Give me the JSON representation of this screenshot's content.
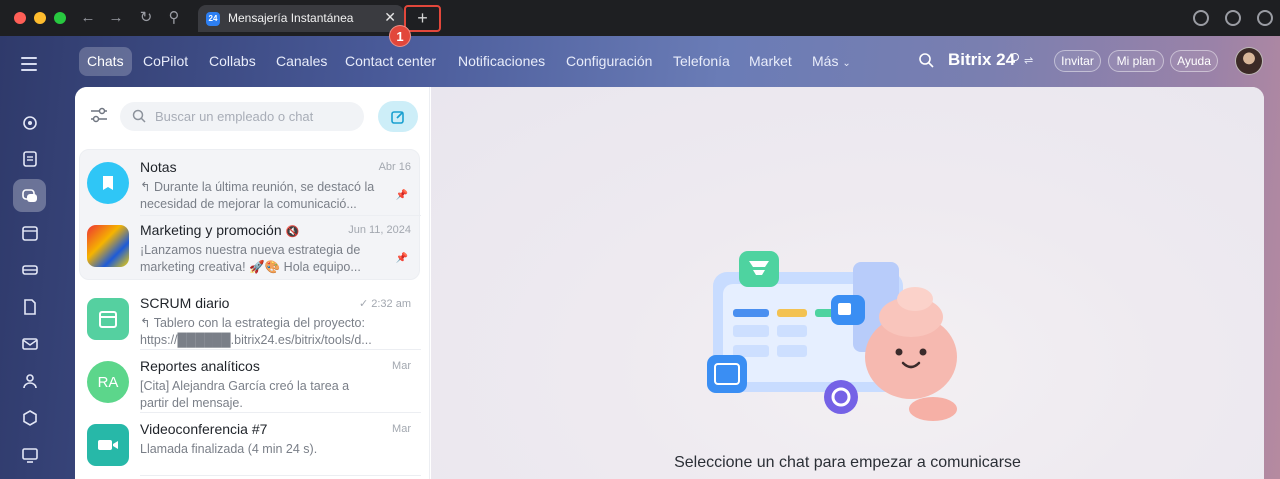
{
  "browser": {
    "tab_title": "Mensajería Instantánea",
    "tab_favicon": "24",
    "new_tab_symbol": "+",
    "step_marker": "1"
  },
  "menu": {
    "items": [
      {
        "label": "Chats",
        "active": true
      },
      {
        "label": "CoPilot"
      },
      {
        "label": "Collabs"
      },
      {
        "label": "Canales"
      },
      {
        "label": "Contact center"
      },
      {
        "label": "Notificaciones"
      },
      {
        "label": "Configuración"
      },
      {
        "label": "Telefonía"
      },
      {
        "label": "Market"
      },
      {
        "label": "Más"
      }
    ],
    "brand": "Bitrix 24",
    "invite": "Invitar",
    "plan": "Mi plan",
    "help": "Ayuda"
  },
  "chat_list": {
    "search_placeholder": "Buscar un empleado o chat",
    "chats": [
      {
        "title": "Notas",
        "date": "Abr 16",
        "preview": "↰ Durante la última reunión, se destacó la necesidad de mejorar la comunicació...",
        "pinned": true,
        "avatar_color": "#2fc6f6"
      },
      {
        "title": "Marketing y promoción",
        "date": "Jun 11, 2024",
        "preview": "¡Lanzamos nuestra nueva estrategia de marketing creativa! 🚀🎨 Hola equipo...",
        "pinned": true
      },
      {
        "title": "SCRUM diario",
        "date": "2:32 am",
        "preview": "↰ Tablero con la estrategia del proyecto: https://██████.bitrix24.es/bitrix/tools/d...",
        "avatar_color": "#55d0a0"
      },
      {
        "title": "Reportes analíticos",
        "date": "Mar",
        "preview": "[Cita] Alejandra García creó la tarea a partir del mensaje.",
        "avatar_initials": "RA",
        "avatar_color": "#5cd68b"
      },
      {
        "title": "Videoconferencia #7",
        "date": "Mar",
        "preview": "Llamada finalizada (4 min 24 s).",
        "avatar_color": "#27b8a8"
      }
    ]
  },
  "empty_state": {
    "message": "Seleccione un chat para empezar a comunicarse"
  },
  "colors": {
    "accent": "#2fc6f6",
    "highlight": "#e2473b"
  }
}
